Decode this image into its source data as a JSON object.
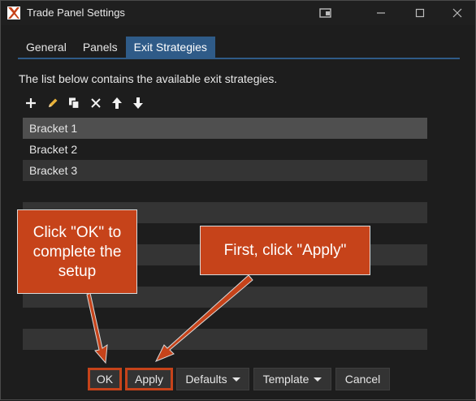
{
  "window": {
    "title": "Trade Panel Settings"
  },
  "tabs": [
    {
      "label": "General",
      "active": false
    },
    {
      "label": "Panels",
      "active": false
    },
    {
      "label": "Exit Strategies",
      "active": true
    }
  ],
  "description": "The list below contains the available exit strategies.",
  "toolbar": {
    "icons": [
      "add-icon",
      "edit-icon",
      "copy-icon",
      "delete-icon",
      "move-up-icon",
      "move-down-icon"
    ]
  },
  "list": {
    "items": [
      "Bracket 1",
      "Bracket 2",
      "Bracket 3",
      "",
      "",
      "",
      "",
      "",
      "",
      "",
      ""
    ]
  },
  "buttons": {
    "ok": "OK",
    "apply": "Apply",
    "defaults": "Defaults",
    "template": "Template",
    "cancel": "Cancel"
  },
  "callouts": {
    "ok": "Click \"OK\" to complete the setup",
    "apply": "First, click \"Apply\""
  },
  "colors": {
    "accent": "#2f5b88",
    "callout": "#c6431a"
  }
}
